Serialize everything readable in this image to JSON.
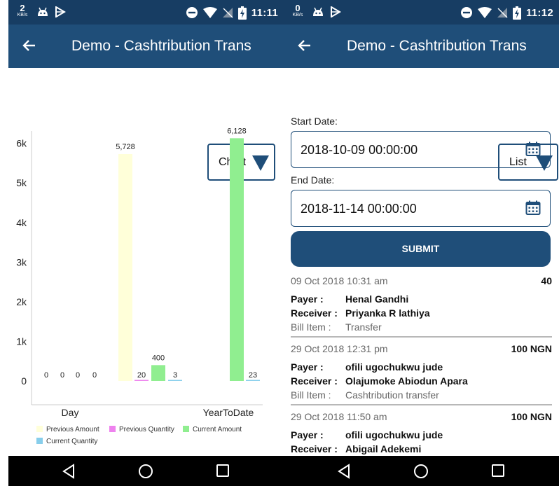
{
  "left": {
    "status": {
      "net_speed": "2",
      "net_unit": "KB/s",
      "time": "11:11"
    },
    "header": {
      "title": "Demo - Cashtribution Trans"
    },
    "view_mode": {
      "label": "Chart"
    },
    "chart_data": {
      "type": "bar",
      "categories": [
        "Day",
        "YearToDate"
      ],
      "series": [
        {
          "name": "Previous Amount",
          "color": "#ffffd9",
          "values": [
            0,
            5728
          ],
          "labels": [
            "0",
            "5,728"
          ]
        },
        {
          "name": "Previous Quantity",
          "color": "#ee82ee",
          "values": [
            0,
            20
          ],
          "labels": [
            "0",
            "20"
          ]
        },
        {
          "name": "Current Amount",
          "color": "#90ee90",
          "values": [
            0,
            400
          ],
          "labels": [
            "0",
            "400"
          ]
        },
        {
          "name": "Current Quantity",
          "color": "#87ceeb",
          "values": [
            0,
            3
          ],
          "labels": [
            "0",
            "3"
          ]
        },
        {
          "name": "",
          "color": "#90ee90",
          "values": [
            0,
            6128
          ],
          "labels": [
            "",
            "6,128"
          ]
        },
        {
          "name": "",
          "color": "#87ceeb",
          "values": [
            0,
            23
          ],
          "labels": [
            "",
            "23"
          ]
        }
      ],
      "y_ticks": [
        "0",
        "1k",
        "2k",
        "3k",
        "4k",
        "5k",
        "6k"
      ],
      "ylim": [
        0,
        6400
      ],
      "legend": [
        "Previous Amount",
        "Previous Quantity",
        "Current Amount",
        "Current Quantity"
      ],
      "legend_position": "bottom-left",
      "grid": false
    }
  },
  "right": {
    "status": {
      "net_speed": "0",
      "net_unit": "KB/s",
      "time": "11:12"
    },
    "header": {
      "title": "Demo - Cashtribution Trans"
    },
    "view_mode": {
      "label": "List"
    },
    "filters": {
      "start_label": "Start Date:",
      "start_value": "2018-10-09 00:00:00",
      "end_label": "End Date:",
      "end_value": "2018-11-14 00:00:00",
      "submit_label": "SUBMIT"
    },
    "transactions": [
      {
        "date": "09 Oct 2018 10:31 am",
        "amount": "40",
        "payer_label": "Payer :",
        "payer": "Henal Gandhi",
        "receiver_label": "Receiver :",
        "receiver": "Priyanka R lathiya",
        "bill_label": "Bill Item :",
        "bill": "Transfer"
      },
      {
        "date": "29 Oct 2018 12:31 pm",
        "amount": "100 NGN",
        "payer_label": "Payer :",
        "payer": "ofili ugochukwu jude",
        "receiver_label": "Receiver :",
        "receiver": "Olajumoke Abiodun Apara",
        "bill_label": "Bill Item :",
        "bill": "Cashtribution transfer"
      },
      {
        "date": "29 Oct 2018 11:50 am",
        "amount": "100 NGN",
        "payer_label": "Payer :",
        "payer": "ofili ugochukwu jude",
        "receiver_label": "Receiver :",
        "receiver": "Abigail Adekemi"
      }
    ]
  },
  "icons": {
    "back": "arrow-left-icon",
    "dropdown": "triangle-down-icon",
    "calendar": "calendar-icon",
    "nav": [
      "back-triangle-icon",
      "home-circle-icon",
      "recents-square-icon"
    ],
    "status": [
      "android-icon",
      "play-store-icon",
      "do-not-disturb-icon",
      "wifi-icon",
      "no-sim-icon",
      "battery-charging-icon"
    ]
  }
}
